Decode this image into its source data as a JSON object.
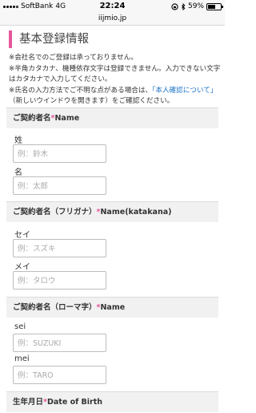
{
  "status": {
    "carrier": "SoftBank",
    "network": "4G",
    "time": "22:24",
    "battery_pct": "59%",
    "battery_level": 0.59
  },
  "url": "iijmio.jp",
  "page": {
    "title": "基本登録情報",
    "notes": [
      "※会社名でのご登録は承っておりません。",
      "※半角カタカナ、機種依存文字は登録できません。入力できない文字はカタカナで入力してください。"
    ],
    "note3_before": "※氏名の入力方法でご不明な点がある場合は、",
    "note3_link": "「本人確認について」",
    "note3_after": "（新しいウインドウを開きます）をご確認ください。"
  },
  "sections": [
    {
      "title": "ご契約者名",
      "req": "*",
      "en": "Name",
      "fields": [
        {
          "label": "姓",
          "placeholder": "例：鈴木"
        },
        {
          "label": "名",
          "placeholder": "例：太郎"
        }
      ]
    },
    {
      "title": "ご契約者名（フリガナ）",
      "req": "*",
      "en": "Name(katakana)",
      "fields": [
        {
          "label": "セイ",
          "placeholder": "例：スズキ"
        },
        {
          "label": "メイ",
          "placeholder": "例：タロウ"
        }
      ]
    },
    {
      "title": "ご契約者名（ローマ字）",
      "req": "*",
      "en": "Name",
      "fields": [
        {
          "label": "sei",
          "placeholder": "例：SUZUKI"
        },
        {
          "label": "mei",
          "placeholder": "例：TARO"
        }
      ]
    },
    {
      "title": "生年月日",
      "req": "*",
      "en": "Date of Birth",
      "fields": []
    }
  ]
}
